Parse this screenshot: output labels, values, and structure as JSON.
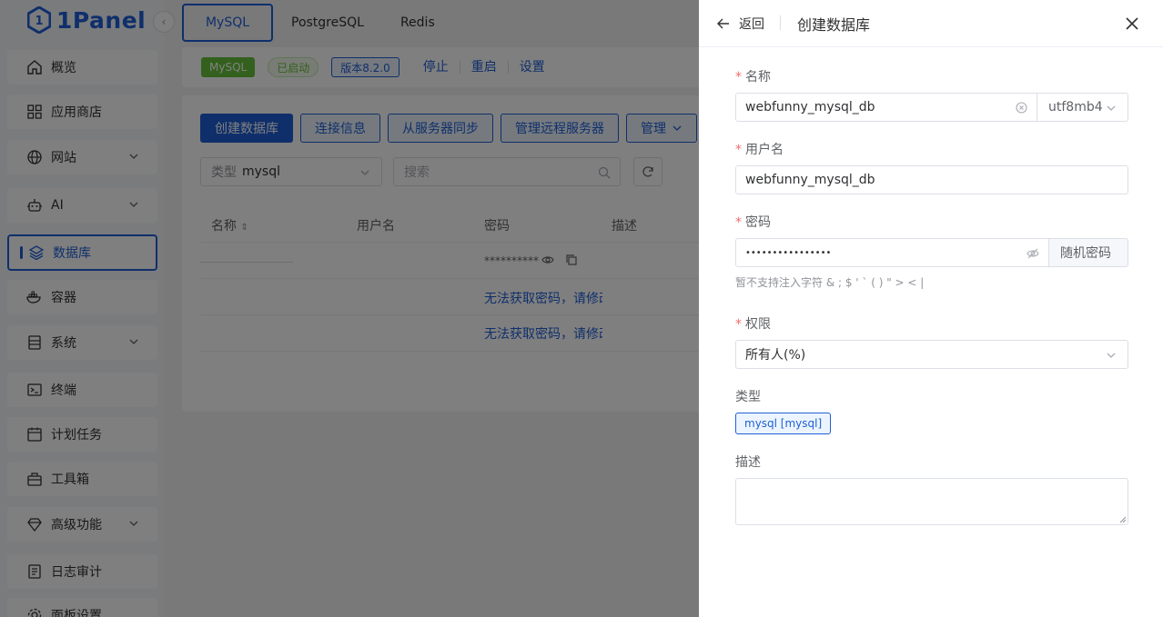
{
  "app": {
    "logo_text": "1Panel"
  },
  "sidebar": {
    "items": [
      {
        "label": "概览",
        "icon": "home-icon"
      },
      {
        "label": "应用商店",
        "icon": "grid-icon"
      },
      {
        "label": "网站",
        "icon": "globe-icon"
      },
      {
        "label": "AI",
        "icon": "robot-icon"
      },
      {
        "label": "数据库",
        "icon": "layers-icon"
      },
      {
        "label": "容器",
        "icon": "docker-icon"
      },
      {
        "label": "系统",
        "icon": "server-icon"
      },
      {
        "label": "终端",
        "icon": "terminal-icon"
      },
      {
        "label": "计划任务",
        "icon": "calendar-icon"
      },
      {
        "label": "工具箱",
        "icon": "toolbox-icon"
      },
      {
        "label": "高级功能",
        "icon": "diamond-icon"
      },
      {
        "label": "日志审计",
        "icon": "log-icon"
      },
      {
        "label": "面板设置",
        "icon": "gear-icon"
      }
    ]
  },
  "tabs": [
    {
      "label": "MySQL"
    },
    {
      "label": "PostgreSQL"
    },
    {
      "label": "Redis"
    }
  ],
  "status": {
    "app_tag": "MySQL",
    "state": "已启动",
    "version": "版本8.2.0",
    "actions": [
      "停止",
      "重启",
      "设置"
    ]
  },
  "toolbar": {
    "buttons": [
      "创建数据库",
      "连接信息",
      "从服务器同步",
      "管理远程服务器",
      "管理"
    ]
  },
  "filter": {
    "type_label": "类型",
    "type_value": "mysql",
    "search_placeholder": "搜索"
  },
  "table": {
    "headers": [
      "名称",
      "用户名",
      "密码",
      "描述"
    ],
    "rows": [
      {
        "password": "**********",
        "error": ""
      },
      {
        "password": "",
        "error": "无法获取密码，请修改"
      },
      {
        "password": "",
        "error": "无法获取密码，请修改"
      }
    ]
  },
  "drawer": {
    "back_label": "返回",
    "title": "创建数据库",
    "name_label": "名称",
    "name_value": "webfunny_mysql_db",
    "charset_value": "utf8mb4",
    "username_label": "用户名",
    "username_value": "webfunny_mysql_db",
    "password_label": "密码",
    "password_value": "••••••••••••••••",
    "random_password_label": "随机密码",
    "password_hint": "暂不支持注入字符 & ; $ ' ` ( ) \" > < |",
    "permission_label": "权限",
    "permission_value": "所有人(%)",
    "type_label": "类型",
    "type_value": "mysql [mysql]",
    "description_label": "描述",
    "description_value": ""
  },
  "colors": {
    "primary": "#1f5fd6",
    "success": "#67c23a",
    "danger": "#f56c6c"
  }
}
